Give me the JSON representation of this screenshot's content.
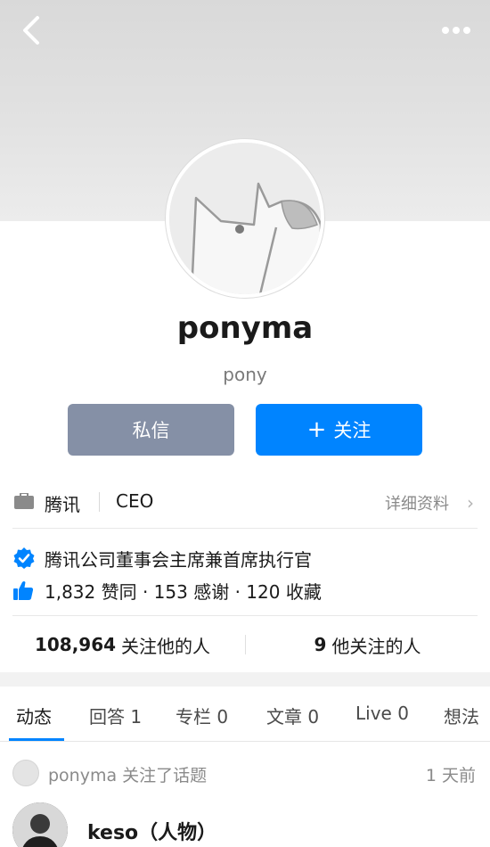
{
  "profile": {
    "name": "ponyma",
    "headline": "pony"
  },
  "actions": {
    "message_label": "私信",
    "follow_plus": "+",
    "follow_label": "关注"
  },
  "employment": {
    "company": "腾讯",
    "title": "CEO",
    "details_label": "详细资料",
    "chevron": "›"
  },
  "verification": {
    "text": "腾讯公司董事会主席兼首席执行官",
    "badge_color": "#0084ff"
  },
  "achievements": {
    "text": "1,832 赞同 · 153 感谢 · 120 收藏"
  },
  "follow_stats": {
    "followers_count": "108,964",
    "followers_label": "关注他的人",
    "following_count": "9",
    "following_label": "他关注的人"
  },
  "tabs": [
    {
      "label": "动态"
    },
    {
      "label": "回答 1"
    },
    {
      "label": "专栏 0"
    },
    {
      "label": "文章 0"
    },
    {
      "label": "Live 0"
    },
    {
      "label": "想法"
    }
  ],
  "feed": {
    "activity_text": "ponyma 关注了话题",
    "time": "1 天前",
    "topic_name": "keso（人物）"
  },
  "colors": {
    "accent": "#0084ff",
    "message_button": "#8590a6"
  }
}
